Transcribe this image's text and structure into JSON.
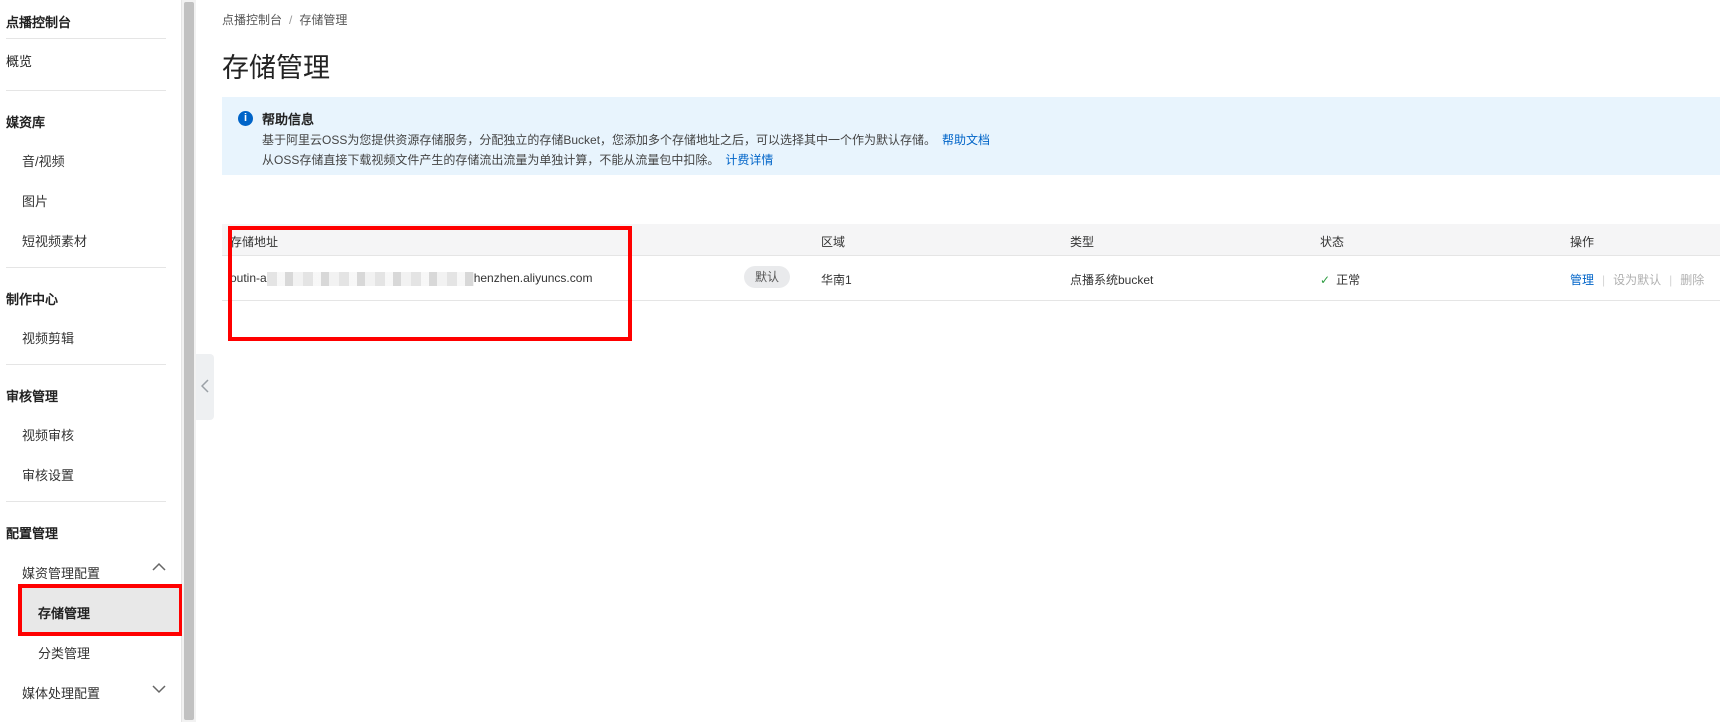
{
  "sidebar": {
    "title": "点播控制台",
    "overview": "概览",
    "media_library": {
      "title": "媒资库",
      "items": [
        "音/视频",
        "图片",
        "短视频素材"
      ]
    },
    "production_center": {
      "title": "制作中心",
      "items": [
        "视频剪辑"
      ]
    },
    "review": {
      "title": "审核管理",
      "items": [
        "视频审核",
        "审核设置"
      ]
    },
    "config": {
      "title": "配置管理",
      "media_config": "媒资管理配置",
      "media_config_items": [
        "存储管理",
        "分类管理"
      ],
      "media_processing": "媒体处理配置"
    }
  },
  "breadcrumb": {
    "root": "点播控制台",
    "separator": "/",
    "current": "存储管理"
  },
  "page_title": "存储管理",
  "help": {
    "title": "帮助信息",
    "line1": "基于阿里云OSS为您提供资源存储服务，分配独立的存储Bucket，您添加多个存储地址之后，可以选择其中一个作为默认存储。",
    "line1_link": "帮助文档",
    "line2": "从OSS存储直接下载视频文件产生的存储流出流量为单独计算，不能从流量包中扣除。",
    "line2_link": "计费详情"
  },
  "table": {
    "headers": {
      "address": "存储地址",
      "region": "区域",
      "type": "类型",
      "status": "状态",
      "actions": "操作"
    },
    "rows": [
      {
        "address_prefix": "outin-a",
        "address_suffix": "henzhen.aliyuncs.com",
        "default_badge": "默认",
        "region": "华南1",
        "type": "点播系统bucket",
        "status": "正常",
        "actions": {
          "manage": "管理",
          "set_default": "设为默认",
          "delete": "删除"
        }
      }
    ]
  },
  "colors": {
    "accent": "#0064c8",
    "success": "#2e9d42",
    "highlight": "#ff0000",
    "help_bg": "#e8f4fd"
  }
}
